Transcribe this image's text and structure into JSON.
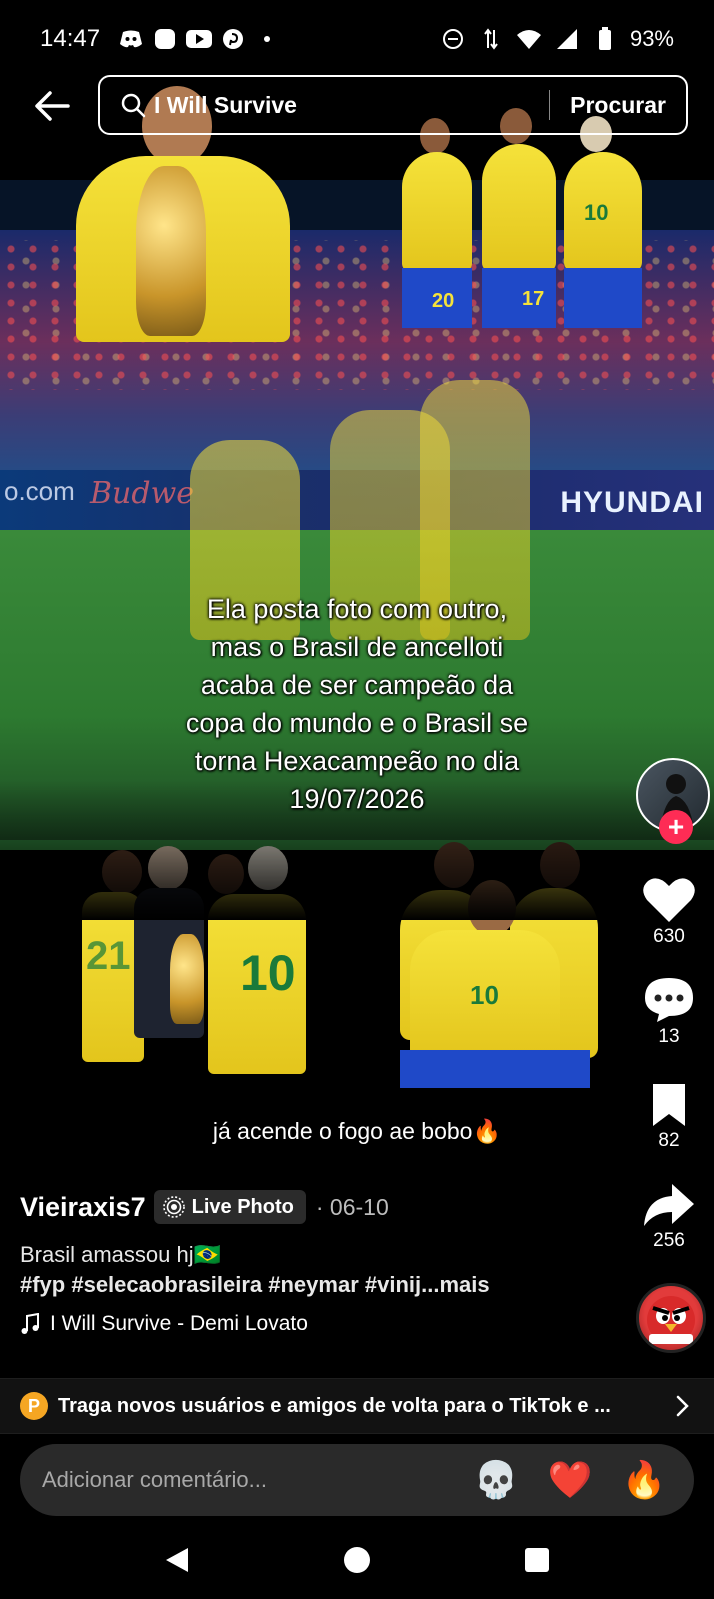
{
  "status_bar": {
    "time": "14:47",
    "battery": "93%"
  },
  "search": {
    "query": "I Will Survive",
    "button_label": "Procurar"
  },
  "video": {
    "caption_lines": [
      "Ela posta foto com outro,",
      "mas o Brasil de ancelloti",
      "acaba de ser campeão da",
      "copa do mundo e o Brasil se",
      "torna Hexacampeão no dia",
      "19/07/2026"
    ],
    "sub_caption": "já acende o fogo ae bobo🔥",
    "ad_texts": [
      "o.com",
      "Budwe",
      "HYUNDAI"
    ],
    "jersey_numbers": [
      "20",
      "17",
      "10",
      "21",
      "10",
      "10"
    ]
  },
  "rail": {
    "likes": "630",
    "comments": "13",
    "saves": "82",
    "shares": "256"
  },
  "post": {
    "author": "Vieiraxis7",
    "live_photo_label": "Live Photo",
    "date": "· 06-10",
    "description": "Brasil amassou hj🇧🇷",
    "hashtags": "#fyp #selecaobrasileira #neymar #vinij...",
    "more_label": "mais",
    "music": "I Will Survive - Demi Lovato"
  },
  "promo": {
    "coin_label": "P",
    "text": "Traga novos usuários e amigos de volta para o TikTok e ..."
  },
  "comment": {
    "placeholder": "Adicionar comentário...",
    "emojis": [
      "💀",
      "❤️",
      "🔥"
    ]
  },
  "colors": {
    "brand_red": "#fe2c55",
    "jersey_yellow": "#f5e23a",
    "shorts_blue": "#1f49c8",
    "coin_orange": "#f5a623"
  }
}
